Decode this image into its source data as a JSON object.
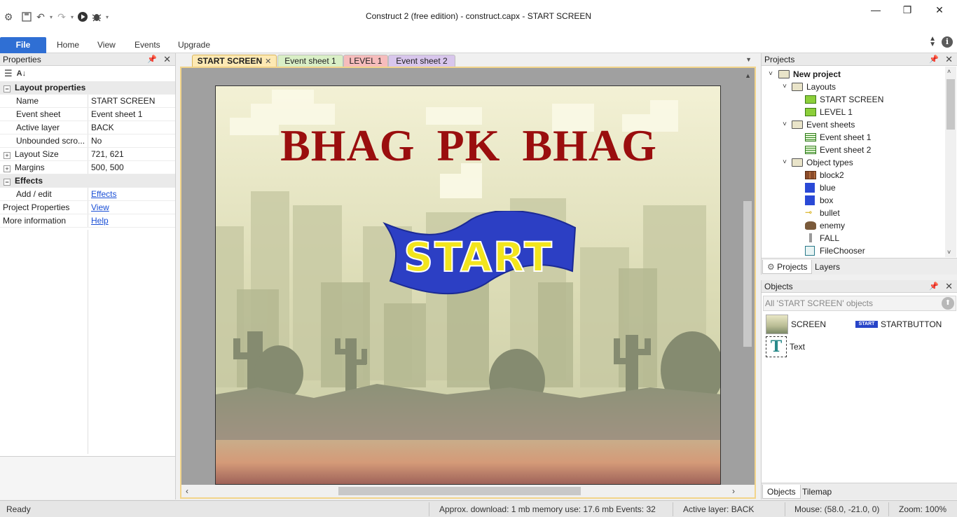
{
  "window": {
    "title": "Construct 2  (free edition) - construct.capx - START SCREEN",
    "controls": {
      "minimize": "—",
      "restore": "❐",
      "close": "✕"
    }
  },
  "quick_access": {
    "icons": [
      "app-gear-icon",
      "save-icon",
      "undo-icon",
      "redo-icon",
      "run-icon",
      "debug-icon",
      "customize-icon"
    ]
  },
  "ribbon": {
    "tabs": [
      "File",
      "Home",
      "View",
      "Events",
      "Upgrade"
    ],
    "active": "File",
    "accent_color": "#2f6fd4"
  },
  "properties": {
    "header": "Properties",
    "section_layout": "Layout properties",
    "rows": [
      {
        "key": "Name",
        "value": "START SCREEN"
      },
      {
        "key": "Event sheet",
        "value": "Event sheet 1"
      },
      {
        "key": "Active layer",
        "value": "BACK"
      },
      {
        "key": "Unbounded scro...",
        "value": "No"
      },
      {
        "key": "Layout Size",
        "value": "721, 621"
      },
      {
        "key": "Margins",
        "value": "500, 500"
      }
    ],
    "section_effects": "Effects",
    "effects_row": {
      "key": "Add / edit",
      "value": "Effects"
    },
    "project_properties": {
      "key": "Project Properties",
      "value": "View"
    },
    "more_info": {
      "key": "More information",
      "value": "Help"
    }
  },
  "doc_tabs": [
    {
      "label": "START SCREEN",
      "color": "#fde9b3",
      "active": true
    },
    {
      "label": "Event sheet 1",
      "color": "#d9efc6"
    },
    {
      "label": "LEVEL 1",
      "color": "#f6bcbc"
    },
    {
      "label": "Event sheet 2",
      "color": "#d8c6ec"
    }
  ],
  "layout_view": {
    "game_title": "BHAG  PK  BHAG",
    "start_button_text": "START",
    "title_color": "#9a0e0e",
    "banner_color": "#2c3fc4",
    "banner_text_color": "#f2e51d"
  },
  "projects": {
    "header": "Projects",
    "root": "New project",
    "layouts_folder": "Layouts",
    "layouts": [
      "START SCREEN",
      "LEVEL 1"
    ],
    "event_sheets_folder": "Event sheets",
    "event_sheets": [
      "Event sheet 1",
      "Event sheet 2"
    ],
    "object_types_folder": "Object types",
    "object_types": [
      {
        "name": "block2",
        "icon": "brick-icon"
      },
      {
        "name": "blue",
        "icon": "blue-square-icon"
      },
      {
        "name": "box",
        "icon": "blue-square-icon"
      },
      {
        "name": "bullet",
        "icon": "bullet-icon"
      },
      {
        "name": "enemy",
        "icon": "enemy-icon"
      },
      {
        "name": "FALL",
        "icon": "fall-icon"
      },
      {
        "name": "FileChooser",
        "icon": "file-chooser-icon"
      }
    ],
    "tabs": [
      "Projects",
      "Layers"
    ]
  },
  "objects": {
    "header": "Objects",
    "filter": "All 'START SCREEN' objects",
    "items": [
      "SCREEN",
      "STARTBUTTON",
      "Text"
    ],
    "startbutton_thumb": "START",
    "text_thumb": "T",
    "tabs": [
      "Objects",
      "Tilemap"
    ]
  },
  "status": {
    "ready": "Ready",
    "download": "Approx. download: 1 mb  memory use: 17.6 mb  Events: 32",
    "active_layer": "Active layer: BACK",
    "mouse": "Mouse: (58.0, -21.0, 0)",
    "zoom": "Zoom: 100%"
  }
}
